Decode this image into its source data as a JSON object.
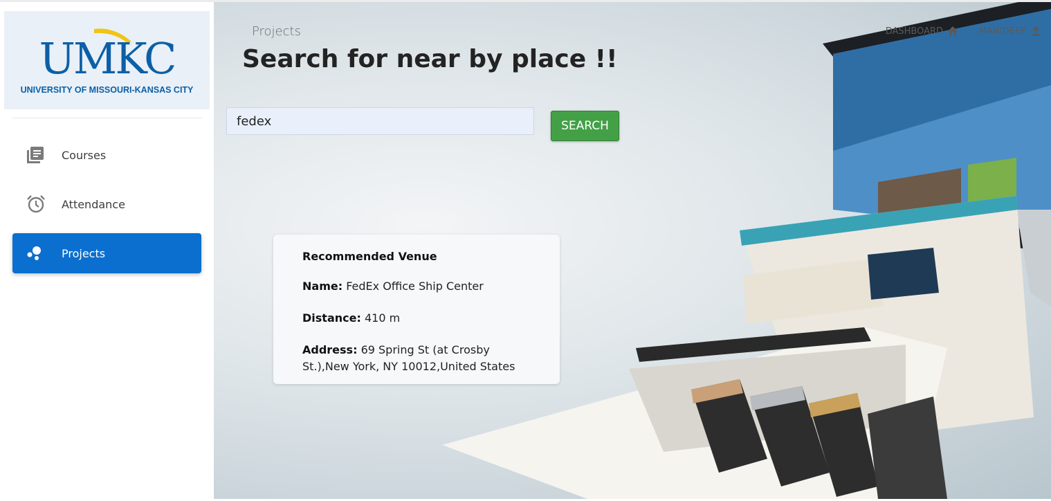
{
  "sidebar": {
    "logo": {
      "mark": "UMKC",
      "subtitle": "UNIVERSITY OF MISSOURI-KANSAS CITY"
    },
    "items": [
      {
        "label": "Courses",
        "icon": "book-icon",
        "active": false
      },
      {
        "label": "Attendance",
        "icon": "alarm-clock-icon",
        "active": false
      },
      {
        "label": "Projects",
        "icon": "bubbles-icon",
        "active": true
      }
    ]
  },
  "header": {
    "breadcrumb": "Projects",
    "title": "Search for near by place !!",
    "nav": {
      "dashboard_label": "DASHBOARD",
      "dashboard_icon": "home-icon",
      "user_label": "MANIDEEP",
      "user_icon": "person-icon"
    }
  },
  "search": {
    "value": "fedex",
    "button_label": "SEARCH"
  },
  "venue": {
    "heading": "Recommended Venue",
    "name_label": "Name:",
    "name": "FedEx Office Ship Center",
    "distance_label": "Distance:",
    "distance": "410 m",
    "address_label": "Address:",
    "address": "69 Spring St (at Crosby St.),New York, NY 10012,United States"
  },
  "colors": {
    "accent": "#0b6fcf",
    "brand": "#0c5fa6",
    "search_button": "#43a047"
  }
}
